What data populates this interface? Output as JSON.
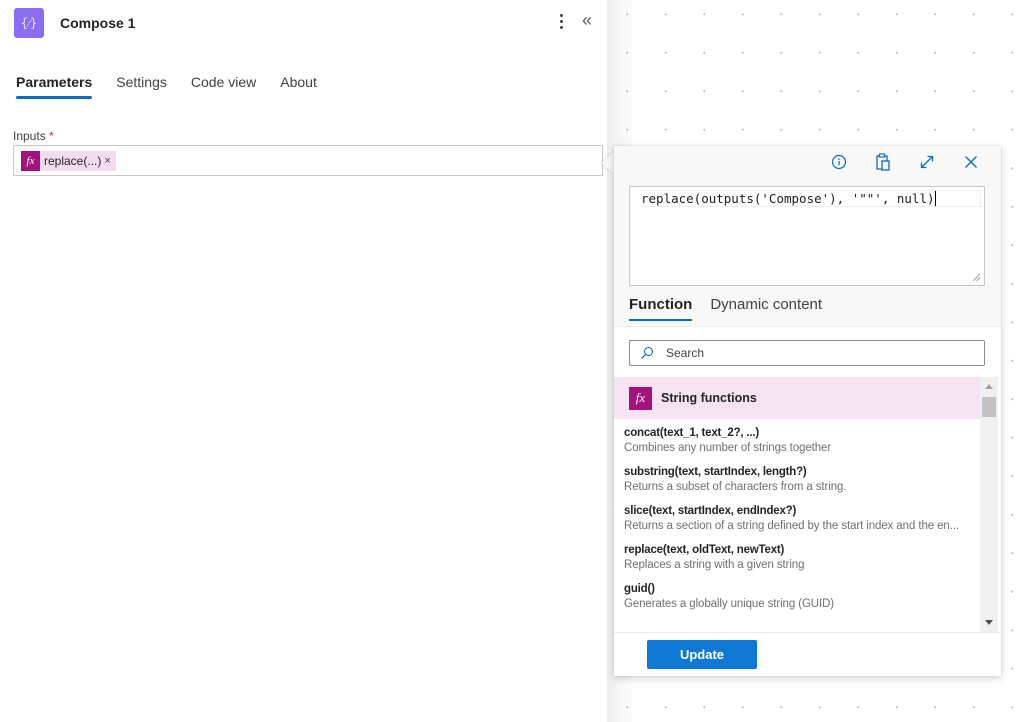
{
  "panel": {
    "header": {
      "icon": "compose-icon",
      "icon_glyph": "{⁄}",
      "title": "Compose 1",
      "more_icon": "more-vertical-icon",
      "collapse_icon": "double-chevron-left-icon",
      "collapse_glyph": "«"
    },
    "tabs": [
      {
        "label": "Parameters",
        "active": true
      },
      {
        "label": "Settings",
        "active": false
      },
      {
        "label": "Code view",
        "active": false
      },
      {
        "label": "About",
        "active": false
      }
    ],
    "inputs": {
      "label": "Inputs",
      "required_mark": "*",
      "token": {
        "icon_glyph": "fx",
        "label": "replace(...)",
        "remove_glyph": "×"
      }
    }
  },
  "expression_editor": {
    "icons": [
      "info-icon",
      "clipboard-icon",
      "expand-icon",
      "close-icon"
    ],
    "expression": "replace(outputs('Compose'), '\"\"', null)",
    "tabs": [
      {
        "label": "Function",
        "active": true
      },
      {
        "label": "Dynamic content",
        "active": false
      }
    ],
    "search": {
      "placeholder": "Search",
      "value": ""
    },
    "category": {
      "icon_glyph": "fx",
      "label": "String functions"
    },
    "functions": [
      {
        "name": "concat(text_1, text_2?, ...)",
        "description": "Combines any number of strings together"
      },
      {
        "name": "substring(text, startIndex, length?)",
        "description": "Returns a subset of characters from a string."
      },
      {
        "name": "slice(text, startIndex, endIndex?)",
        "description": "Returns a section of a string defined by the start index and the en..."
      },
      {
        "name": "replace(text, oldText, newText)",
        "description": "Replaces a string with a given string"
      },
      {
        "name": "guid()",
        "description": "Generates a globally unique string (GUID)"
      }
    ],
    "update_label": "Update"
  },
  "colors": {
    "accent": "#0f6cbd",
    "button": "#0f78d4",
    "header_icon": "#8c6cf2",
    "fx_badge": "#a4127c",
    "token_bg": "#f4dcf0",
    "category_bg": "#f5e3f2"
  }
}
